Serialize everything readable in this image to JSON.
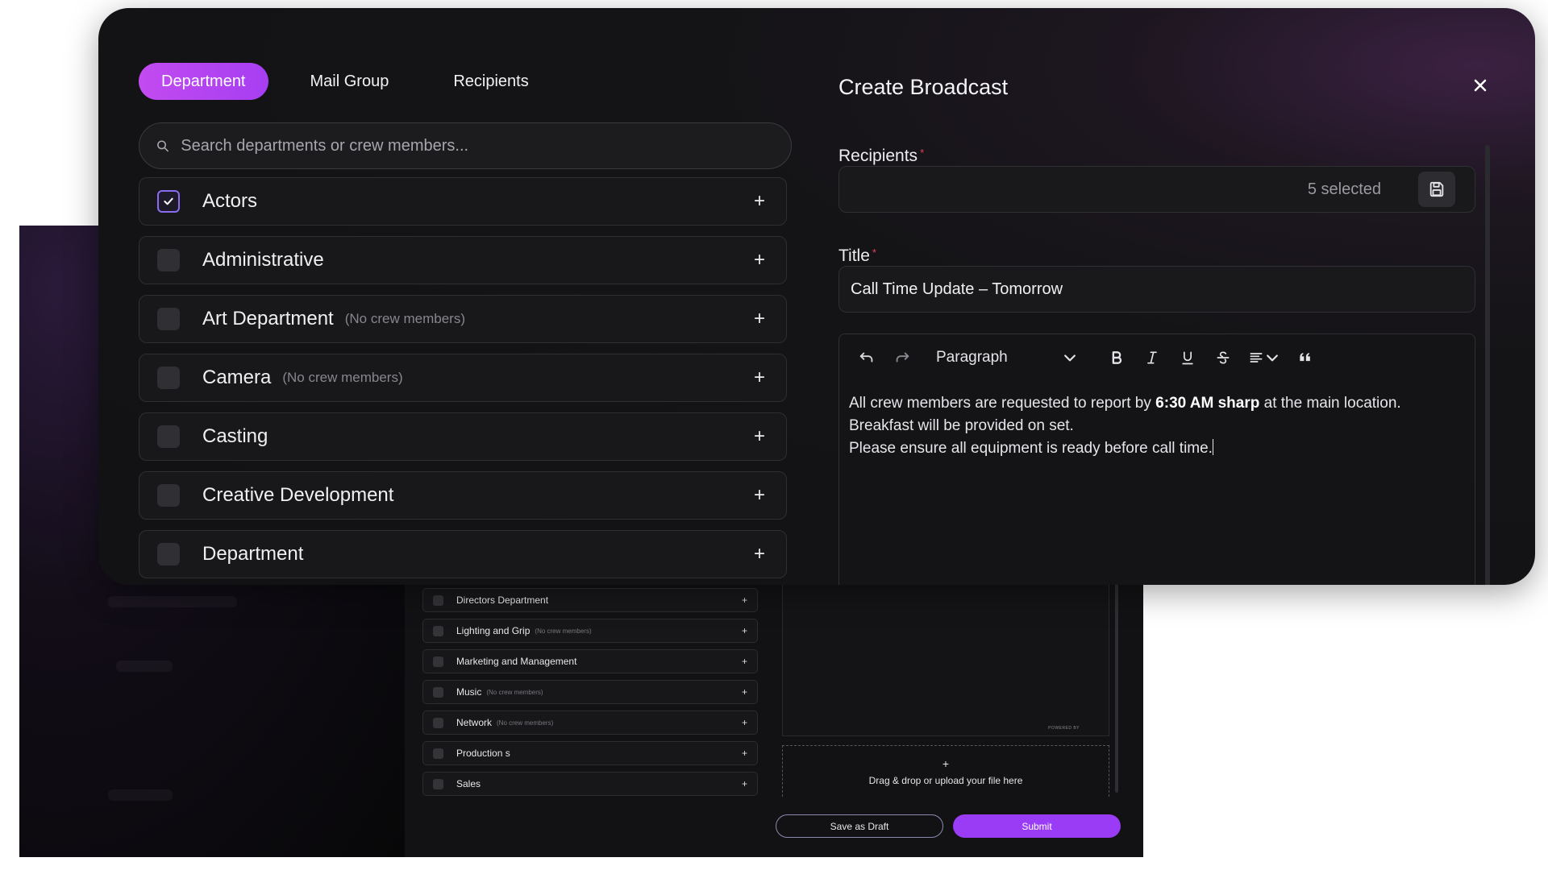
{
  "background_app": {
    "departments": [
      {
        "name": "Directors Department",
        "note": ""
      },
      {
        "name": "Lighting and Grip",
        "note": "(No crew members)"
      },
      {
        "name": "Marketing and Management",
        "note": ""
      },
      {
        "name": "Music",
        "note": "(No crew members)"
      },
      {
        "name": "Network",
        "note": "(No crew members)"
      },
      {
        "name": "Production s",
        "note": ""
      },
      {
        "name": "Sales",
        "note": ""
      }
    ],
    "powered_by": "POWERED BY",
    "upload_plus": "+",
    "upload_text": "Drag & drop or upload your file here",
    "save_draft_label": "Save as Draft",
    "submit_label": "Submit"
  },
  "modal": {
    "tabs": [
      {
        "label": "Department",
        "active": true
      },
      {
        "label": "Mail Group",
        "active": false
      },
      {
        "label": "Recipients",
        "active": false
      }
    ],
    "search_placeholder": "Search departments or crew members...",
    "departments": [
      {
        "name": "Actors",
        "note": "",
        "checked": true
      },
      {
        "name": "Administrative",
        "note": "",
        "checked": false
      },
      {
        "name": "Art Department",
        "note": "(No crew members)",
        "checked": false
      },
      {
        "name": "Camera",
        "note": "(No crew members)",
        "checked": false
      },
      {
        "name": "Casting",
        "note": "",
        "checked": false
      },
      {
        "name": "Creative Development",
        "note": "",
        "checked": false
      },
      {
        "name": "Department",
        "note": "",
        "checked": false
      }
    ],
    "add_symbol": "+",
    "panel_title": "Create Broadcast",
    "recipients_label": "Recipients",
    "recipients_value": "5 selected",
    "title_label": "Title",
    "required_mark": "*",
    "title_value": "Call Time Update – Tomorrow",
    "editor": {
      "block_format": "Paragraph",
      "line1_pre": "All crew members are requested to report by ",
      "line1_bold": "6:30 AM sharp",
      "line1_post": " at the main location.",
      "line2": "Breakfast will be provided on set.",
      "line3": "Please ensure all equipment is ready before call time."
    }
  },
  "colors": {
    "accent_purple": "#a63ef2",
    "checkbox_border": "#8a6cf0",
    "required_red": "#e0445a"
  },
  "icons": [
    "search-icon",
    "check-icon",
    "plus-icon",
    "close-icon",
    "save-icon",
    "undo-icon",
    "redo-icon",
    "chevron-down-icon",
    "bold-icon",
    "italic-icon",
    "underline-icon",
    "strikethrough-icon",
    "align-icon",
    "quote-icon"
  ]
}
